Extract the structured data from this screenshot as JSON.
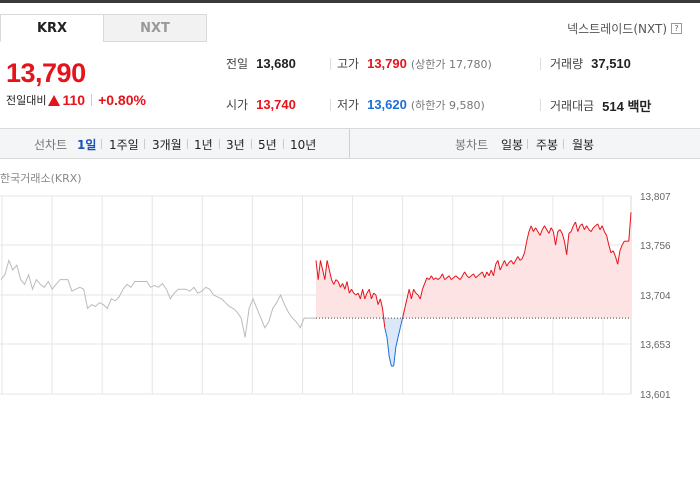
{
  "market_tabs": [
    {
      "label": "KRX",
      "active": true
    },
    {
      "label": "NXT",
      "active": false
    }
  ],
  "nxt_link": {
    "label": "넥스트레이드(NXT)",
    "help_icon": "?"
  },
  "price": {
    "current": "13,790",
    "change_label": "전일대비",
    "change_amount": "110",
    "change_direction": "up",
    "change_percent": "+0.80%"
  },
  "stats": {
    "prev_close": {
      "label": "전일",
      "value": "13,680"
    },
    "high": {
      "label": "고가",
      "value": "13,790",
      "sub": "(상한가 17,780)"
    },
    "volume": {
      "label": "거래량",
      "value": "37,510"
    },
    "open": {
      "label": "시가",
      "value": "13,740"
    },
    "low": {
      "label": "저가",
      "value": "13,620",
      "sub": "(하한가 9,580)"
    },
    "trade_value": {
      "label": "거래대금",
      "value": "514 백만"
    }
  },
  "period_tabs": {
    "line_label": "선차트",
    "line_items": [
      "1일",
      "1주일",
      "3개월",
      "1년",
      "3년",
      "5년",
      "10년"
    ],
    "active": "1일",
    "candle_label": "봉차트",
    "candle_items": [
      "일봉",
      "주봉",
      "월봉"
    ]
  },
  "chart_caption": "한국거래소(KRX)",
  "colors": {
    "up": "#e5131c",
    "down": "#1a6fd8",
    "prev_day_line": "#bbbbbb"
  },
  "chart_data": {
    "type": "line",
    "title": "",
    "ylim": [
      13601,
      13807
    ],
    "yticks": [
      "13,807",
      "13,756",
      "13,704",
      "13,653",
      "13,601"
    ],
    "ytick_values": [
      13807,
      13756,
      13704,
      13653,
      13601
    ],
    "baseline": 13680,
    "grid": true,
    "series": [
      {
        "values": [
          13720,
          13725,
          13740,
          13730,
          13735,
          13720,
          13715,
          13725,
          13710,
          13720,
          13715,
          13712,
          13718,
          13710,
          13715,
          13720,
          13720,
          13720,
          13708,
          13710,
          13712,
          13710,
          13690,
          13694,
          13692,
          13696,
          13694,
          13690,
          13700,
          13698,
          13702,
          13710,
          13715,
          13712,
          13718,
          13718,
          13718,
          13718,
          13712,
          13714,
          13712,
          13716,
          13710,
          13700,
          13706,
          13710,
          13710,
          13710,
          13708,
          13712,
          13706,
          13708,
          13712,
          13710,
          13704,
          13702,
          13700,
          13696,
          13692,
          13690,
          13686,
          13680,
          13660,
          13690,
          13700,
          13690,
          13680,
          13670,
          13676,
          13690,
          13696,
          13704,
          13694,
          13686,
          13680,
          13676,
          13670,
          13680,
          13680,
          13680,
          13680
        ]
      },
      {
        "values": [
          13740,
          13720,
          13740,
          13730,
          13720,
          13740,
          13730,
          13720,
          13715,
          13720,
          13718,
          13712,
          13716,
          13710,
          13718,
          13706,
          13710,
          13706,
          13704,
          13706,
          13700,
          13710,
          13700,
          13706,
          13710,
          13700,
          13706,
          13704,
          13694,
          13700,
          13690,
          13670,
          13660,
          13640,
          13630,
          13630,
          13650,
          13660,
          13670,
          13680,
          13690,
          13700,
          13710,
          13700,
          13710,
          13706,
          13704,
          13700,
          13710,
          13716,
          13722,
          13720,
          13724,
          13720,
          13722,
          13720,
          13722,
          13726,
          13720,
          13722,
          13724,
          13720,
          13722,
          13724,
          13722,
          13720,
          13724,
          13728,
          13724,
          13722,
          13724,
          13726,
          13722,
          13724,
          13726,
          13728,
          13722,
          13728,
          13724,
          13730,
          13724,
          13736,
          13740,
          13730,
          13735,
          13740,
          13734,
          13738,
          13740,
          13736,
          13740,
          13744,
          13740,
          13742,
          13748,
          13760,
          13770,
          13776,
          13770,
          13774,
          13770,
          13766,
          13772,
          13776,
          13772,
          13768,
          13774,
          13770,
          13756,
          13770,
          13772,
          13768,
          13760,
          13746,
          13768,
          13770,
          13776,
          13780,
          13770,
          13776,
          13778,
          13772,
          13776,
          13772,
          13770,
          13774,
          13776,
          13778,
          13772,
          13776,
          13770,
          13766,
          13756,
          13748,
          13750,
          13744,
          13736,
          13750,
          13756,
          13760,
          13760,
          13760,
          13790
        ]
      }
    ]
  }
}
